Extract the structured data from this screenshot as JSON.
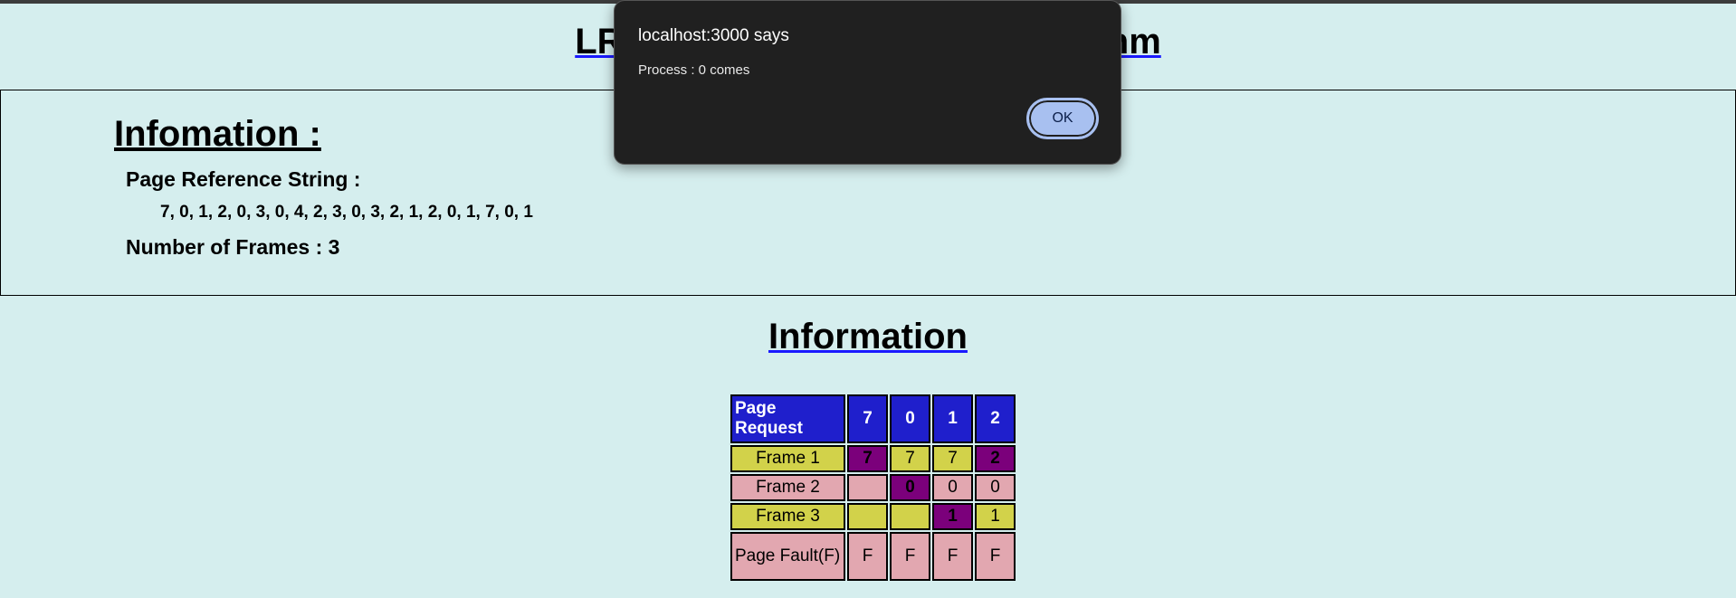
{
  "page": {
    "title": "LRU Page Replacement Algorithm",
    "info_heading": "Infomation :",
    "ref_label": "Page Reference String :",
    "ref_string": "7, 0, 1, 2, 0, 3, 0, 4, 2, 3, 0, 3, 2, 1, 2, 0, 1, 7, 0, 1",
    "frames_label": "Number of Frames : 3",
    "section_heading": "Information"
  },
  "table": {
    "header_label": "Page Request",
    "requests": [
      "7",
      "0",
      "1",
      "2"
    ],
    "rows": [
      {
        "label": "Frame 1",
        "values": [
          "7",
          "7",
          "7",
          "2"
        ],
        "hits": [
          true,
          false,
          false,
          true
        ]
      },
      {
        "label": "Frame 2",
        "values": [
          "",
          "0",
          "0",
          "0"
        ],
        "hits": [
          false,
          true,
          false,
          false
        ]
      },
      {
        "label": "Frame 3",
        "values": [
          "",
          "",
          "1",
          "1"
        ],
        "hits": [
          false,
          false,
          true,
          false
        ]
      }
    ],
    "fault_label": "Page Fault(F)",
    "faults": [
      "F",
      "F",
      "F",
      "F"
    ]
  },
  "dialog": {
    "title": "localhost:3000 says",
    "message": "Process : 0 comes",
    "ok_label": "OK"
  },
  "colors": {
    "background": "#d5eeee",
    "header": "#1f1fcc",
    "yellow_row": "#d2d24a",
    "pink_row": "#e2a7b0",
    "highlight": "#7b007b",
    "dialog_bg": "#202020",
    "ok_button": "#a8c0f0"
  }
}
